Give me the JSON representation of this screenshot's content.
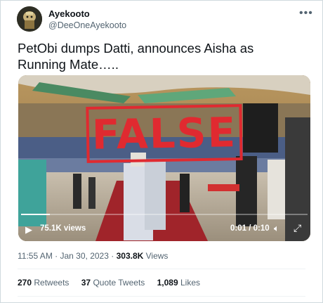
{
  "user": {
    "display_name": "Ayekooto",
    "handle": "@DeeOneAyekooto"
  },
  "icons": {
    "avatar": "avatar-image",
    "more": "more-horizontal-icon",
    "play": "play-icon",
    "volume": "volume-icon",
    "fullscreen": "fullscreen-icon"
  },
  "tweet": {
    "text": "PetObi dumps Datti, announces Aisha as Running Mate….."
  },
  "video": {
    "stamp_text": "FALSE",
    "views": "75.1K views",
    "time": "0:01 / 0:10",
    "progress_fraction": 0.1,
    "stamp_color": "#e02a30"
  },
  "meta": {
    "time": "11:55 AM",
    "date": "Jan 30, 2023",
    "separator": "·",
    "views_count": "303.8K",
    "views_label": "Views"
  },
  "stats": {
    "retweets_count": "270",
    "retweets_label": "Retweets",
    "quotes_count": "37",
    "quotes_label": "Quote Tweets",
    "likes_count": "1,089",
    "likes_label": "Likes"
  }
}
